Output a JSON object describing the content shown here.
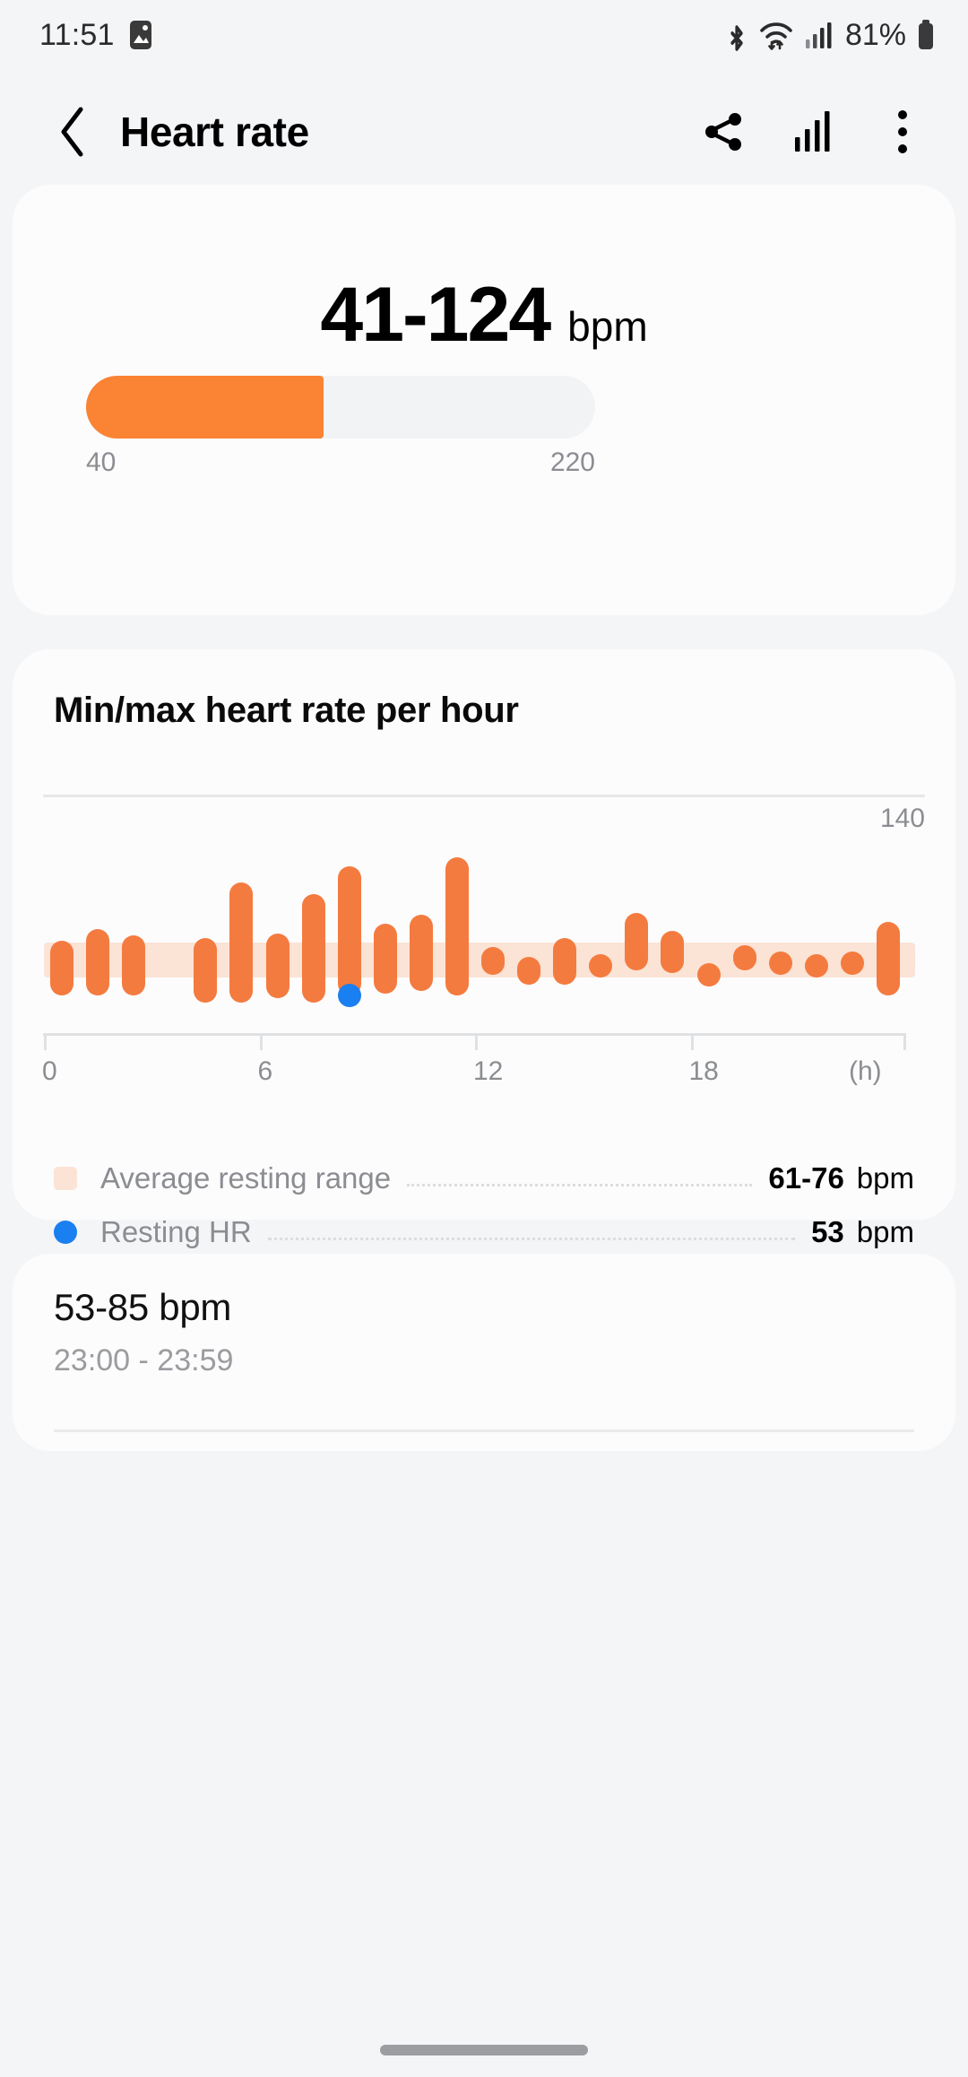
{
  "status_bar": {
    "time": "11:51",
    "battery_percent": "81%",
    "icons": [
      "image-icon",
      "bluetooth-icon",
      "wifi-icon",
      "cellular-signal-icon",
      "battery-icon"
    ]
  },
  "app_bar": {
    "back_icon": "chevron-left-icon",
    "title": "Heart rate",
    "actions": [
      "share-icon",
      "bar-chart-icon",
      "overflow-menu-icon"
    ]
  },
  "summary_card": {
    "value": "41-124",
    "unit": "bpm",
    "range_min_label": "40",
    "range_max_label": "220",
    "range_min": 40,
    "range_max": 220,
    "fill_from": 41,
    "fill_to": 124,
    "fill_color": "#fa8334",
    "track_color": "#f2f3f5"
  },
  "chart_card": {
    "title": "Min/max heart rate per hour",
    "legend": [
      {
        "swatch": "square",
        "color": "#fbe3d6",
        "label": "Average resting range",
        "value": "61-76",
        "unit": "bpm"
      },
      {
        "swatch": "dot",
        "color": "#1a7ff0",
        "label": "Resting HR",
        "value": "53",
        "unit": "bpm"
      }
    ]
  },
  "detail_card": {
    "value": "53-85 bpm",
    "time_range": "23:00 - 23:59"
  },
  "chart_data": {
    "type": "bar",
    "title": "Min/max heart rate per hour",
    "xlabel": "(h)",
    "ylabel": "",
    "unit": "bpm",
    "grid": true,
    "gridlines": [
      140
    ],
    "ylim": [
      40,
      150
    ],
    "xlim": [
      0,
      24
    ],
    "xticks": [
      0,
      6,
      12,
      18
    ],
    "xticklabels": [
      "0",
      "6",
      "12",
      "18"
    ],
    "x_axis_unit_label": "(h)",
    "top_gridline_label": "140",
    "bar_color": "#f47b3f",
    "resting_band": {
      "label": "Average resting range",
      "low": 61,
      "high": 76,
      "color": "#fbe3d6"
    },
    "resting_hr": {
      "label": "Resting HR",
      "value": 53,
      "hour": 8,
      "color": "#1a7ff0"
    },
    "categories": [
      "0",
      "1",
      "2",
      "3",
      "4",
      "5",
      "6",
      "7",
      "8",
      "9",
      "10",
      "11",
      "12",
      "13",
      "14",
      "15",
      "16",
      "17",
      "18",
      "19",
      "20",
      "21",
      "22",
      "23"
    ],
    "series": [
      {
        "name": "min",
        "values": [
          53,
          53,
          53,
          null,
          50,
          50,
          52,
          50,
          53,
          54,
          55,
          53,
          62,
          58,
          58,
          63,
          64,
          63,
          58,
          64,
          67,
          68,
          64,
          53
        ]
      },
      {
        "name": "max",
        "values": [
          77,
          82,
          79,
          null,
          78,
          102,
          80,
          97,
          109,
          84,
          88,
          113,
          74,
          70,
          78,
          71,
          89,
          81,
          67,
          75,
          72,
          71,
          72,
          85
        ]
      }
    ]
  }
}
